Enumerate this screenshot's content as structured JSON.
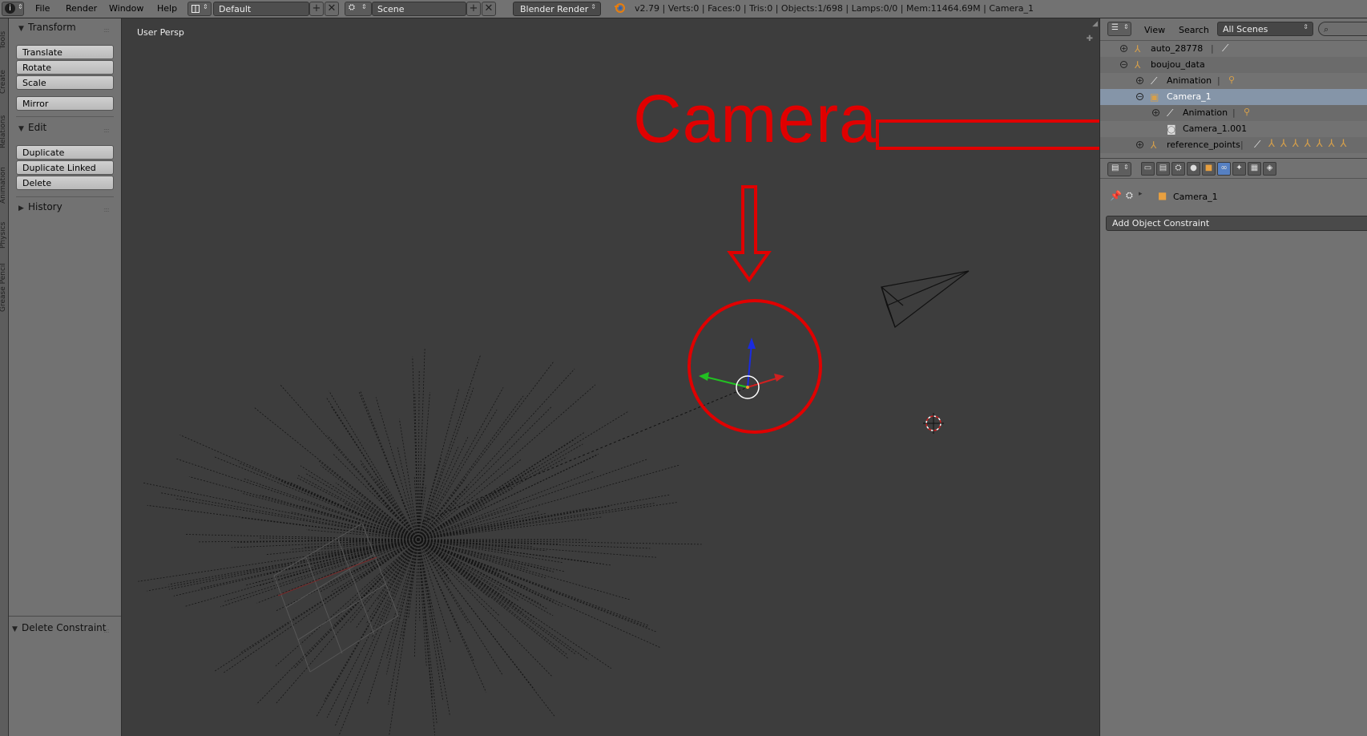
{
  "menubar": {
    "info_icon": "info-icon",
    "items": [
      "File",
      "Render",
      "Window",
      "Help"
    ],
    "layout_name": "Default",
    "scene_name": "Scene",
    "render_engine": "Blender Render",
    "stats": "v2.79 | Verts:0 | Faces:0 | Tris:0 | Objects:1/698 | Lamps:0/0 | Mem:11464.69M | Camera_1"
  },
  "left_tabs": [
    "Tools",
    "Create",
    "Relations",
    "Animation",
    "Physics",
    "Grease Pencil"
  ],
  "toolshelf": {
    "transform": {
      "title": "Transform",
      "buttons": [
        "Translate",
        "Rotate",
        "Scale"
      ],
      "mirror": "Mirror"
    },
    "edit": {
      "title": "Edit",
      "buttons": [
        "Duplicate",
        "Duplicate Linked",
        "Delete"
      ]
    },
    "history": {
      "title": "History"
    },
    "operator": {
      "title": "Delete Constraint"
    }
  },
  "viewport": {
    "label": "User Persp"
  },
  "annotation": {
    "text": "Camera",
    "color": "#e00000"
  },
  "outliner": {
    "view_label": "View",
    "search_label": "Search",
    "scenes_select": "All Scenes",
    "rows": [
      {
        "name": "auto_28778"
      },
      {
        "name": "boujou_data"
      },
      {
        "name": "Animation"
      },
      {
        "name": "Camera_1"
      },
      {
        "name": "Animation"
      },
      {
        "name": "Camera_1.001"
      },
      {
        "name": "reference_points"
      }
    ]
  },
  "properties": {
    "breadcrumb": "Camera_1",
    "add_constraint": "Add Object Constraint"
  }
}
